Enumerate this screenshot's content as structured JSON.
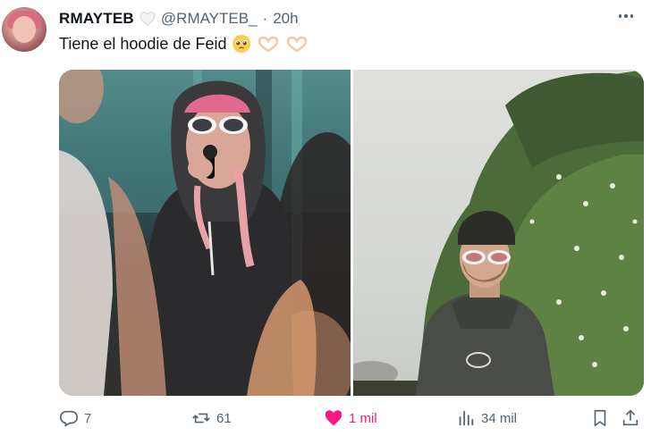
{
  "tweet": {
    "display_name": "RMAYTEB",
    "handle": "@RMAYTEB_",
    "separator": "·",
    "time": "20h",
    "text": "Tiene el hoodie de Feid",
    "emojis": [
      "pleading-face",
      "heart-hands",
      "heart-hands"
    ]
  },
  "actions": {
    "replies": "7",
    "reposts": "61",
    "likes": "1 mil",
    "views": "34 mil"
  },
  "colors": {
    "like_active": "#f91880",
    "secondary_text": "#536471",
    "primary_text": "#0f1419"
  }
}
